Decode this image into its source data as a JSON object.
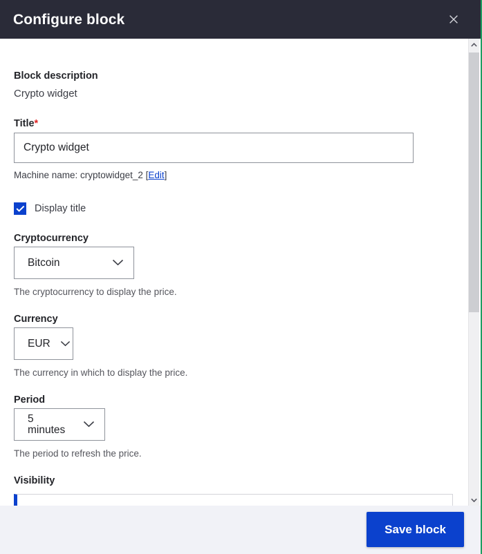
{
  "header": {
    "title": "Configure block",
    "close_icon": "close-icon"
  },
  "form": {
    "block_description": {
      "label": "Block description",
      "value": "Crypto widget"
    },
    "title": {
      "label": "Title",
      "required_marker": "*",
      "value": "Crypto widget",
      "placeholder": "",
      "machine_name_prefix": "Machine name: cryptowidget_2 [",
      "machine_name_edit": "Edit",
      "machine_name_suffix": "]"
    },
    "display_title": {
      "label": "Display title",
      "checked": true
    },
    "cryptocurrency": {
      "label": "Cryptocurrency",
      "value": "Bitcoin",
      "description": "The cryptocurrency to display the price.",
      "chevron_icon": "chevron-down-icon"
    },
    "currency": {
      "label": "Currency",
      "value": "EUR",
      "description": "The currency in which to display the price.",
      "chevron_icon": "chevron-down-icon"
    },
    "period": {
      "label": "Period",
      "value": "5 minutes",
      "description": "The period to refresh the price.",
      "chevron_icon": "chevron-down-icon"
    },
    "visibility": {
      "label": "Visibility"
    }
  },
  "scrollbar": {
    "up_icon": "chevron-up-icon",
    "down_icon": "chevron-down-icon"
  },
  "footer": {
    "save_label": "Save block"
  },
  "colors": {
    "header_background": "#2a2b38",
    "accent_blue": "#0b41cd",
    "footer_background": "#f1f2f7",
    "required_red": "#e02424",
    "right_edge_green": "#1e9e62"
  }
}
